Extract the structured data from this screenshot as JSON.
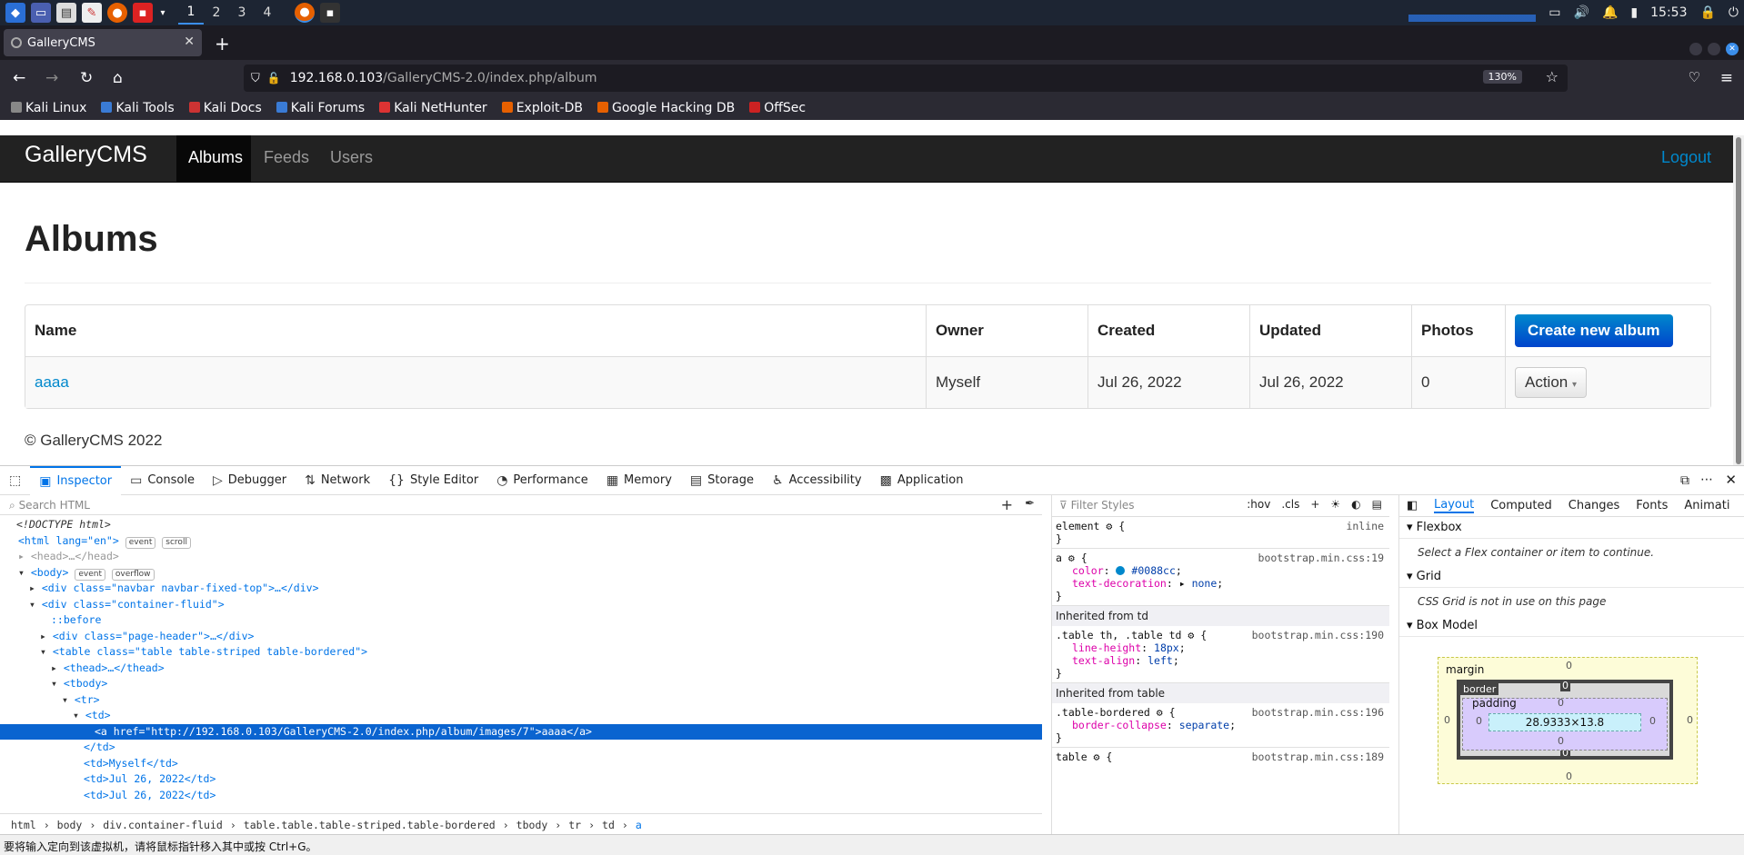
{
  "taskbar": {
    "workspaces": [
      "1",
      "2",
      "3",
      "4"
    ],
    "clock": "15:53"
  },
  "browser": {
    "tab_title": "GalleryCMS",
    "url_host": "192.168.0.103",
    "url_path": "/GalleryCMS-2.0/index.php/album",
    "zoom": "130%",
    "bookmarks": [
      "Kali Linux",
      "Kali Tools",
      "Kali Docs",
      "Kali Forums",
      "Kali NetHunter",
      "Exploit-DB",
      "Google Hacking DB",
      "OffSec"
    ]
  },
  "site": {
    "brand": "GalleryCMS",
    "nav": [
      "Albums",
      "Feeds",
      "Users"
    ],
    "logout": "Logout",
    "heading": "Albums",
    "columns": [
      "Name",
      "Owner",
      "Created",
      "Updated",
      "Photos"
    ],
    "create_button": "Create new album",
    "rows": [
      {
        "name": "aaaa",
        "owner": "Myself",
        "created": "Jul 26, 2022",
        "updated": "Jul 26, 2022",
        "photos": "0",
        "action": "Action"
      }
    ],
    "footer": "© GalleryCMS 2022"
  },
  "devtools": {
    "tabs": [
      "Inspector",
      "Console",
      "Debugger",
      "Network",
      "Style Editor",
      "Performance",
      "Memory",
      "Storage",
      "Accessibility",
      "Application"
    ],
    "search_placeholder": "Search HTML",
    "filter_placeholder": "Filter Styles",
    "hov": ":hov",
    "cls": ".cls",
    "markup": [
      "<!DOCTYPE html>",
      "<html lang=\"en\">",
      "<head>…</head>",
      "<body>",
      "<div class=\"navbar navbar-fixed-top\">…</div>",
      "<div class=\"container-fluid\">",
      "::before",
      "<div class=\"page-header\">…</div>",
      "<table class=\"table table-striped table-bordered\">",
      "<thead>…</thead>",
      "<tbody>",
      "<tr>",
      "<td>",
      "<a href=\"http://192.168.0.103/GalleryCMS-2.0/index.php/album/images/7\">aaaa</a>",
      "</td>",
      "<td>Myself</td>",
      "<td>Jul 26, 2022</td>",
      "<td>Jul 26, 2022</td>"
    ],
    "badges": {
      "event": "event",
      "scroll": "scroll",
      "overflow": "overflow"
    },
    "breadcrumb": [
      "html",
      "body",
      "div.container-fluid",
      "table.table.table-striped.table-bordered",
      "tbody",
      "tr",
      "td",
      "a"
    ],
    "rules": {
      "element": "element",
      "inline": "inline",
      "a_src": "bootstrap.min.css:19",
      "a_color": "#0088cc",
      "a_decoration": "none",
      "inherited_td": "Inherited from td",
      "td_selector": ".table th, .table td",
      "td_src": "bootstrap.min.css:190",
      "line_height": "18px",
      "text_align": "left",
      "inherited_table": "Inherited from table",
      "tb_selector": ".table-bordered",
      "tb_src": "bootstrap.min.css:196",
      "border_collapse": "separate",
      "table_selector": "table",
      "table_src": "bootstrap.min.css:189"
    },
    "sidebar": {
      "tabs": [
        "Layout",
        "Computed",
        "Changes",
        "Fonts",
        "Animati"
      ],
      "flexbox": "Flexbox",
      "flexbox_msg": "Select a Flex container or item to continue.",
      "grid": "Grid",
      "grid_msg": "CSS Grid is not in use on this page",
      "boxmodel": "Box Model",
      "margin": "margin",
      "border": "border",
      "padding": "padding",
      "content_size": "28.9333×13.8",
      "zero": "0"
    }
  },
  "status": "要将输入定向到该虚拟机，请将鼠标指针移入其中或按 Ctrl+G。"
}
